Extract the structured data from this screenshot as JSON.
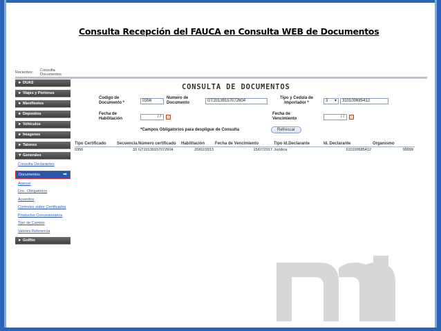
{
  "slide": {
    "title": "Consulta Recepción del FAUCA en Consulta WEB de  Documentos"
  },
  "recent": {
    "label": "Recientes:",
    "link": "Consulta Documentos"
  },
  "sidebar": {
    "items": [
      {
        "label": "► DUAS"
      },
      {
        "label": "► Viajes y Portones"
      },
      {
        "label": "► Manifiestos"
      },
      {
        "label": "► Depositos"
      },
      {
        "label": "► Vehiculos"
      },
      {
        "label": "► Imagenes"
      },
      {
        "label": "► Talones"
      },
      {
        "label": "▼ Generales"
      }
    ],
    "sub_items": [
      {
        "label": "Consulta Declarantes"
      },
      {
        "label": "Documentos"
      },
      {
        "label": "Arancel"
      },
      {
        "label": "Doc. Obligatorios"
      },
      {
        "label": "Acuerdos"
      },
      {
        "label": "Controles sobre Certificados"
      },
      {
        "label": "Productos Concesionarios"
      },
      {
        "label": "Tipo de Cambio"
      },
      {
        "label": "Valores Referencia"
      }
    ],
    "last_item": {
      "label": "► Golfito"
    },
    "active_arrow": "➡"
  },
  "main": {
    "title": "CONSULTA DE DOCUMENTOS",
    "codigo_label": "Codigo de Documento *",
    "codigo_value": "0356",
    "numero_label": "Numero de Documento",
    "numero_value": "GT20139157072604",
    "tipo_label": "Tipo y Cedula de Importador *",
    "tipo_value": "3",
    "cedula_value": "310100685412",
    "fecha_hab_label": "Fecha de Habilitación",
    "fecha_hab_value": "/ /",
    "fecha_venc_label": "Fecha de Vencimiento",
    "fecha_venc_value": "/ /",
    "note": "*Campos Obligatorios para despligue de Consulta",
    "refresh_button": "Refrescar"
  },
  "results": {
    "headers": [
      "Tipo Certificado",
      "Secuencia",
      "Número certificado",
      "Habilitación",
      "Fecha de Vencimiento",
      "Tipo Id.Declarante",
      "Id. Declarante",
      "Organismo"
    ],
    "rows": [
      [
        "0356",
        "33",
        "GT20139157072604",
        "20/02/2013",
        "15/07/2017",
        "Jurídica",
        "310100685412",
        "99999"
      ]
    ]
  }
}
